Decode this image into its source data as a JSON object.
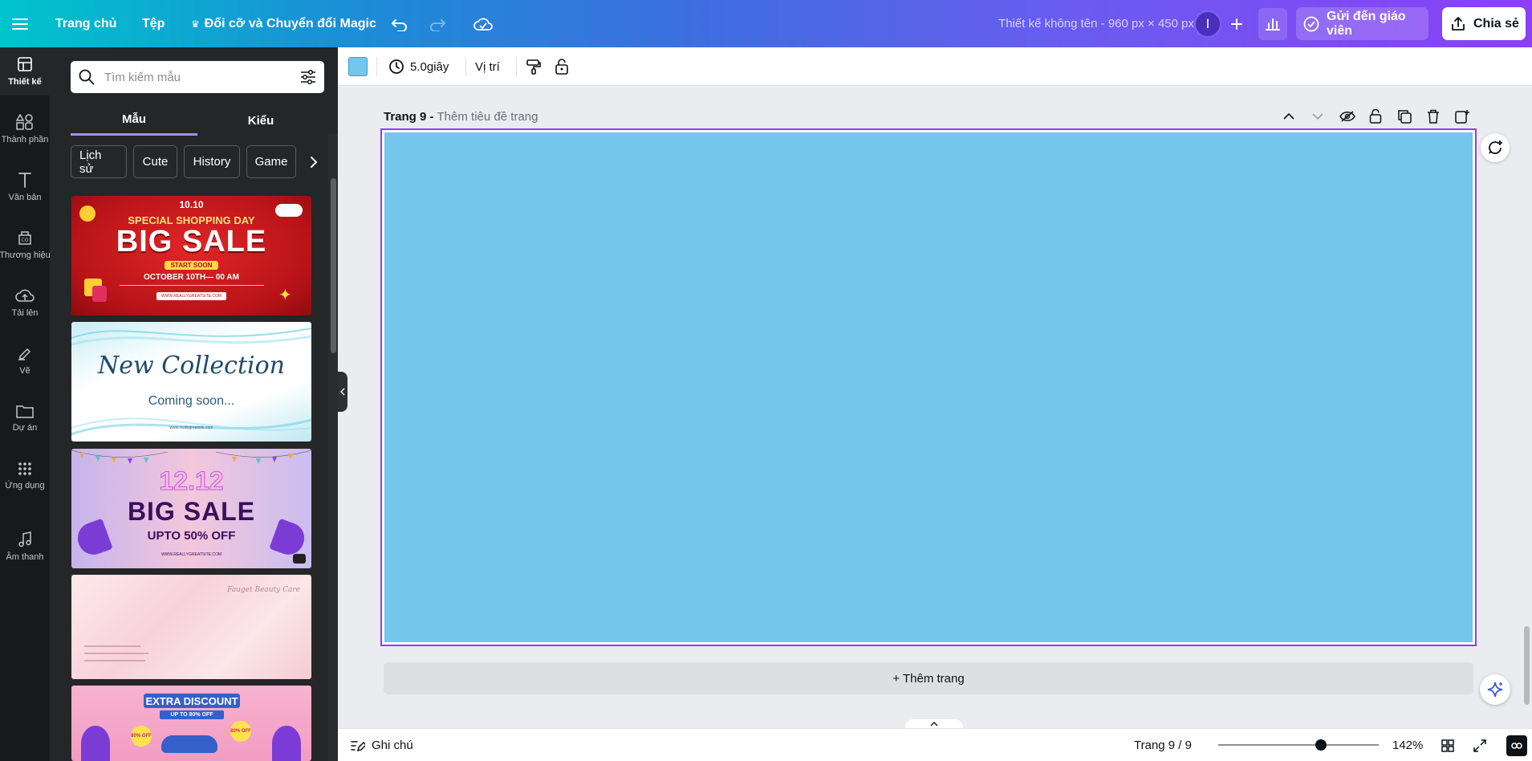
{
  "topbar": {
    "home_label": "Trang chủ",
    "file_label": "Tệp",
    "magic_resize_label": "Đối cỡ và Chuyển đổi Magic",
    "doc_title": "Thiết kế không tên - 960 px × 450 px",
    "avatar_initial": "I",
    "teacher_button_label": "Gửi đến giáo viên",
    "share_button_label": "Chia sẻ"
  },
  "rail": {
    "items": [
      {
        "label": "Thiết kế",
        "icon": "design-icon"
      },
      {
        "label": "Thành phần",
        "icon": "elements-icon"
      },
      {
        "label": "Văn bản",
        "icon": "text-icon"
      },
      {
        "label": "Thương hiệu",
        "icon": "brand-icon"
      },
      {
        "label": "Tải lên",
        "icon": "upload-icon"
      },
      {
        "label": "Vẽ",
        "icon": "draw-icon"
      },
      {
        "label": "Dự án",
        "icon": "folder-icon"
      },
      {
        "label": "Ứng dụng",
        "icon": "apps-icon"
      },
      {
        "label": "Âm thanh",
        "icon": "audio-icon"
      }
    ]
  },
  "panel": {
    "search_placeholder": "Tìm kiếm mẫu",
    "tabs": [
      {
        "label": "Mẫu"
      },
      {
        "label": "Kiểu"
      }
    ],
    "chips": [
      {
        "label": "Lịch sử"
      },
      {
        "label": "Cute"
      },
      {
        "label": "History"
      },
      {
        "label": "Game"
      }
    ],
    "templates": [
      {
        "date": "10.10",
        "title": "SPECIAL SHOPPING DAY",
        "headline": "BIG SALE",
        "badge": "START SOON",
        "when": "OCTOBER 10TH— 00 AM",
        "url": "WWW.REALLYGREATSITE.COM"
      },
      {
        "title": "New Collection",
        "subtitle": "Coming soon...",
        "url": "www.reallygreatsite.com"
      },
      {
        "date": "12.12",
        "headline": "BIG SALE",
        "sub": "UPTO 50% OFF",
        "url": "WWW.REALLYGREATSITE.COM"
      },
      {
        "brand": "Fauget Beauty Care"
      },
      {
        "headline": "EXTRA DISCOUNT",
        "sub": "UP TO 80% OFF",
        "tag_left": "80% OFF",
        "tag_right": "80% OFF"
      }
    ]
  },
  "ctxbar": {
    "color_swatch": "#74c6eb",
    "duration_label": "5.0giây",
    "position_label": "Vị trí"
  },
  "page": {
    "header_label": "Trang 9 -",
    "header_placeholder": "Thêm tiêu đề trang",
    "canvas_color": "#74c6eb",
    "add_page_label": "+ Thêm trang"
  },
  "bottombar": {
    "notes_label": "Ghi chú",
    "page_indicator": "Trang 9 / 9",
    "zoom_label": "142%",
    "zoom_level": 0.64
  },
  "colors": {
    "accent": "#8b3dff",
    "rail_bg": "#18191b",
    "panel_bg": "#252627"
  }
}
